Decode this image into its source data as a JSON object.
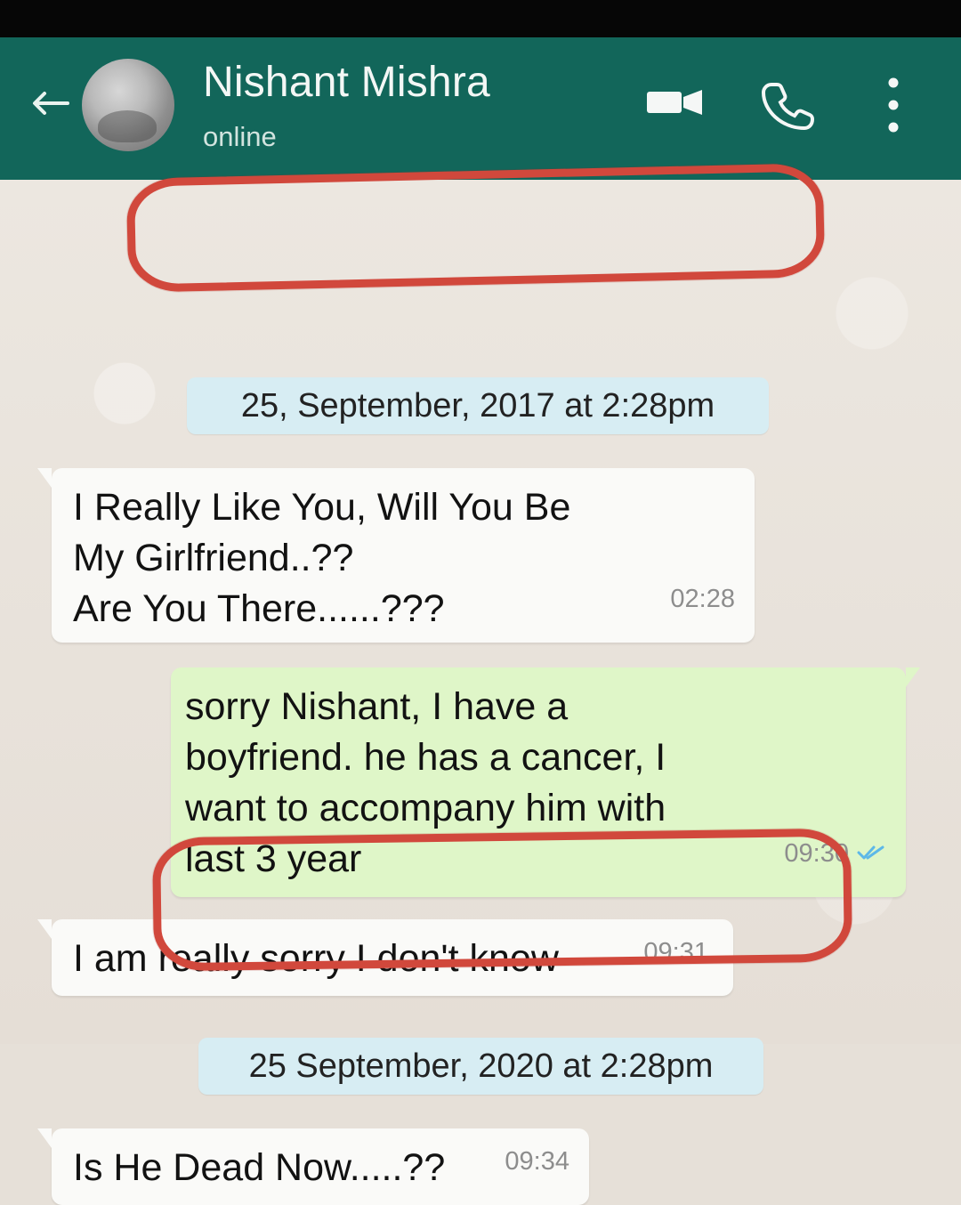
{
  "header": {
    "contact_name": "Nishant Mishra",
    "status": "online"
  },
  "chat": {
    "date_1": "25, September,  2017 at 2:28pm",
    "date_2": "25 September, 2020 at 2:28pm",
    "messages": [
      {
        "direction": "incoming",
        "text": "I Really Like You, Will You Be\nMy Girlfriend..??\nAre You There......???",
        "time": "02:28"
      },
      {
        "direction": "outgoing",
        "text": "sorry Nishant, I have a\nboyfriend. he has a cancer, I\nwant to accompany him with\nlast 3 year",
        "time": "09:30",
        "receipt_icon": "double-check-icon"
      },
      {
        "direction": "incoming",
        "text": "I am really sorry I don't know",
        "time": "09:31"
      },
      {
        "direction": "incoming",
        "text": "Is He Dead Now.....??",
        "time": "09:34"
      }
    ]
  },
  "icons": {
    "back": "arrow-left-icon",
    "video": "video-camera-icon",
    "phone": "phone-icon",
    "more": "more-vertical-icon"
  },
  "colors": {
    "header": "#12665a",
    "incoming_bubble": "#fafaf8",
    "outgoing_bubble": "#dff6c8",
    "date_chip": "#d7edf3",
    "annotation": "#d1483c"
  }
}
